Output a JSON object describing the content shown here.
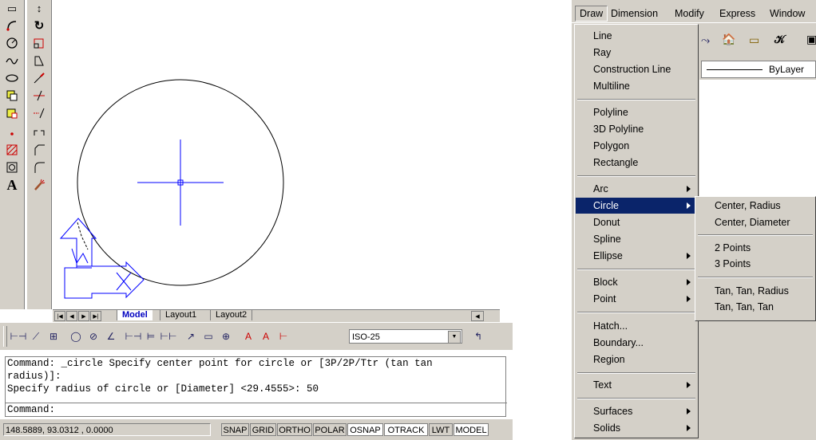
{
  "left_toolbar": {
    "col1_icons": [
      "line-tool-icon",
      "arc-tool-icon",
      "circle-tool-icon",
      "spline-tool-icon",
      "ellipse-tool-icon",
      "insert-block-icon",
      "make-block-icon",
      "point-tool-icon",
      "hatch-tool-icon",
      "region-tool-icon",
      "multiline-text-icon"
    ],
    "col2_icons": [
      "move-icon",
      "rotate-icon",
      "scale-icon",
      "stretch-icon",
      "lengthen-icon",
      "trim-icon",
      "extend-icon",
      "break-icon",
      "chamfer-icon",
      "fillet-icon",
      "explode-icon"
    ]
  },
  "layout_tabs": {
    "model": "Model",
    "layout1": "Layout1",
    "layout2": "Layout2"
  },
  "dim_toolbar": {
    "style_value": "ISO-25"
  },
  "command": {
    "line1": "Command: _circle Specify center point for circle or [3P/2P/Ttr (tan tan",
    "line2": "radius)]:",
    "line3": "Specify radius of circle or [Diameter] <29.4555>: 50",
    "prompt": "Command:"
  },
  "status": {
    "coords": "148.5889, 93.0312 , 0.0000",
    "buttons": [
      "SNAP",
      "GRID",
      "ORTHO",
      "POLAR",
      "OSNAP",
      "OTRACK",
      "LWT",
      "MODEL"
    ]
  },
  "menubar": {
    "items": [
      "Draw",
      "Dimension",
      "Modify",
      "Express",
      "Window"
    ]
  },
  "layer": {
    "value": "ByLayer"
  },
  "draw_menu": {
    "items": [
      {
        "label": "Line"
      },
      {
        "label": "Ray"
      },
      {
        "label": "Construction Line"
      },
      {
        "label": "Multiline"
      },
      {
        "label": "Polyline"
      },
      {
        "label": "3D Polyline"
      },
      {
        "label": "Polygon"
      },
      {
        "label": "Rectangle"
      },
      {
        "label": "Arc"
      },
      {
        "label": "Circle"
      },
      {
        "label": "Donut"
      },
      {
        "label": "Spline"
      },
      {
        "label": "Ellipse"
      },
      {
        "label": "Block"
      },
      {
        "label": "Point"
      },
      {
        "label": "Hatch..."
      },
      {
        "label": "Boundary..."
      },
      {
        "label": "Region"
      },
      {
        "label": "Text"
      },
      {
        "label": "Surfaces"
      },
      {
        "label": "Solids"
      }
    ]
  },
  "circle_submenu": {
    "items": [
      "Center, Radius",
      "Center, Diameter",
      "2 Points",
      "3 Points",
      "Tan, Tan, Radius",
      "Tan, Tan, Tan"
    ]
  },
  "colors": {
    "highlight": "#0a246a",
    "face": "#d4d0c8",
    "ucs_blue": "#0000ff"
  }
}
